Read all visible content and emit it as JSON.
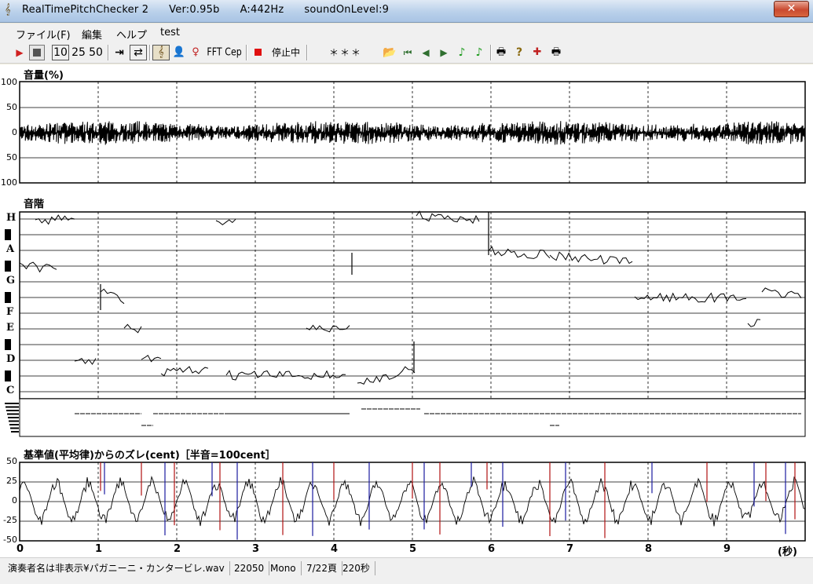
{
  "window": {
    "app_name": "RealTimePitchChecker 2",
    "version": "Ver:0.95b",
    "pitch_ref": "A:442Hz",
    "sound_on_level": "soundOnLevel:9",
    "close_glyph": "✕"
  },
  "menu": {
    "file": "ファイル(F)",
    "edit": "編集",
    "help": "ヘルプ",
    "test": "test"
  },
  "toolbar": {
    "btn_10": "10",
    "btn_25": "25",
    "btn_50": "50",
    "fft": "FFT",
    "cep": "Cep",
    "status": "停止中",
    "stars": "＊＊＊"
  },
  "panels": {
    "volume": {
      "title": "音量(%)",
      "y_labels": [
        "100",
        "50",
        "0",
        "50",
        "100"
      ]
    },
    "scale": {
      "title": "音階",
      "notes": [
        "H",
        "A",
        "G",
        "F",
        "E",
        "D",
        "C"
      ]
    },
    "deviation": {
      "title": "基準値(平均律)からのズレ(cent)［半音=100cent］",
      "y_labels": [
        "50",
        "25",
        "0",
        "-25",
        "-50"
      ]
    }
  },
  "x_axis": {
    "labels": [
      "0",
      "1",
      "2",
      "3",
      "4",
      "5",
      "6",
      "7",
      "8",
      "9"
    ],
    "unit": "(秒)"
  },
  "status": {
    "file": "演奏者名は非表示¥パガニーニ・カンタービレ.wav",
    "rate": "22050",
    "channels": "Mono",
    "page": "7/22頁",
    "length": "220秒"
  }
}
